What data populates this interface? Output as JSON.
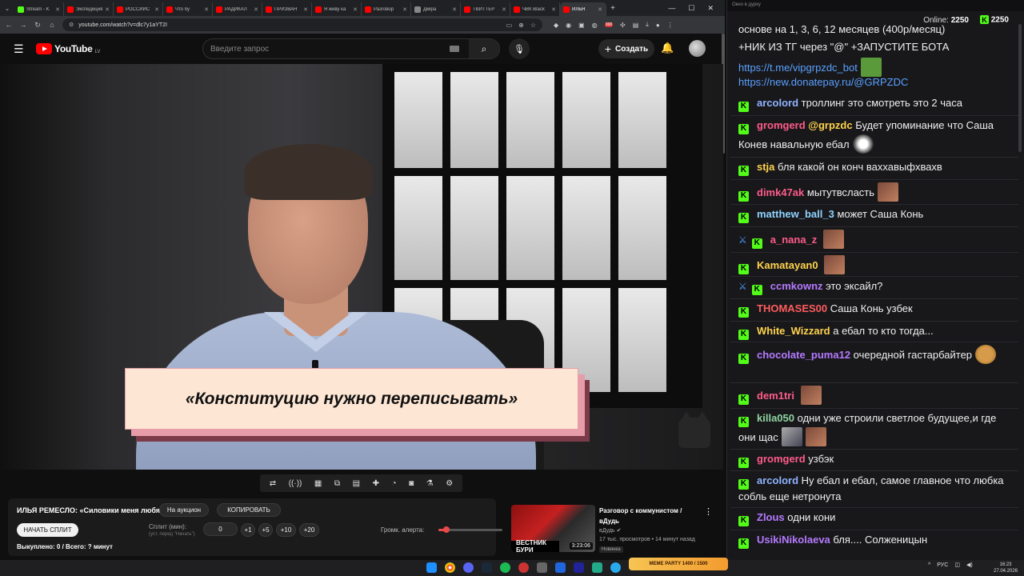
{
  "browser": {
    "tabs": [
      {
        "label": "Stream - K",
        "color": "#53fc18"
      },
      {
        "label": "Экспедиция",
        "color": "#ff0000"
      },
      {
        "label": "РОССИЙС",
        "color": "#ff0000"
      },
      {
        "label": "Что бу",
        "color": "#ff0000"
      },
      {
        "label": "РАДИКАЛ",
        "color": "#ff0000"
      },
      {
        "label": "ПРИЗВАН",
        "color": "#ff0000"
      },
      {
        "label": "Я живу ка",
        "color": "#ff0000"
      },
      {
        "label": "Разговор",
        "color": "#ff0000"
      },
      {
        "label": "Дмірa",
        "color": "#888888"
      },
      {
        "label": "ТВИТТЕР",
        "color": "#ff0000"
      },
      {
        "label": "ЧВК Black",
        "color": "#ff0000"
      },
      {
        "label": "ИЛЬЯ",
        "color": "#ff0000",
        "active": true
      }
    ],
    "url": "youtube.com/watch?v=dlc7y1aYT2I"
  },
  "youtube": {
    "logo_text": "YouTube",
    "country": "LV",
    "search_placeholder": "Введите запрос",
    "create_label": "Создать"
  },
  "video": {
    "quote": "«Конституцию нужно переписывать»"
  },
  "toolbar_icons": [
    "loop-icon",
    "audio-icon",
    "clip-icon",
    "pip-icon",
    "subtitles-icon",
    "cut-icon",
    "speed-icon",
    "screenshot-icon",
    "effects-icon",
    "settings-icon"
  ],
  "info_panel": {
    "title": "ИЛЬЯ РЕМЕСЛО: «Силовики меня любят»",
    "auction_label": "На аукцион",
    "copy_label": "КОПИРОВАТЬ",
    "start_split_label": "НАЧАТЬ СПЛИТ",
    "split_label": "Сплит (мин):",
    "split_hint": "(уст. перед \"Начать\")",
    "split_value": "0",
    "steps": [
      "+1",
      "+5",
      "+10",
      "+20"
    ],
    "volume_label": "Громк. алерта:",
    "volume_fraction": 0.12,
    "bought_text": "Выкуплено: 0 / Всего: ? минут"
  },
  "recommendation": {
    "thumb_band": "ВЕСТНИК БУРИ",
    "duration": "3:23:06",
    "title": "Разговор с коммунистом / вДудь",
    "channel": "вДудь",
    "meta": "17 тыс. просмотров • 14 минут назад",
    "badge": "Новинка"
  },
  "chat": {
    "window_title": "Окно в дурку",
    "online_label": "Online:",
    "online_value": "2250",
    "kick_count": "2250",
    "top_lines": [
      "основе       на 1, 3, 6, 12 месяцев (400р/месяц)",
      "+НИК ИЗ ТГ через \"@\" +ЗАПУСТИТЕ БОТА",
      "https://t.me/vipgrpzdc_bot",
      "https://new.donatepay.ru/@GRPZDC"
    ],
    "messages": [
      {
        "user": "arcolord",
        "color": "#8fb4ff",
        "text": "троллинг это смотреть это 2 часа"
      },
      {
        "user": "gromgerd",
        "color": "#ff5c8a",
        "mention": "@grpzdc",
        "text": "Будет упоминание что Саша Конев навальную ебал",
        "emote": "cat"
      },
      {
        "user": "stja",
        "color": "#ffd34d",
        "text": "бля какой он конч ваххавыфхвахв"
      },
      {
        "user": "dimk47ak",
        "color": "#ff5c8a",
        "text": "мытутвсласть",
        "emote": "face"
      },
      {
        "user": "matthew_ball_3",
        "color": "#8fd3ff",
        "text": "может Саша Конь"
      },
      {
        "user": "a_nana_z",
        "color": "#ff5c8a",
        "text": "",
        "sword": true,
        "emote": "face"
      },
      {
        "user": "Kamatayan0",
        "color": "#ffd34d",
        "text": "",
        "emote": "face"
      },
      {
        "user": "ccmkownz",
        "color": "#b57aff",
        "text": "это эксайл?",
        "sword": true
      },
      {
        "user": "THOMASES00",
        "color": "#ff5c5c",
        "text": "Саша Конь узбек"
      },
      {
        "user": "White_Wizzard",
        "color": "#ffd34d",
        "text": "а ебал то кто тогда..."
      },
      {
        "user": "chocolate_puma12",
        "color": "#b57aff",
        "text": "очередной гастарбайтер",
        "emote": "bear"
      },
      {
        "user": "dem1tri",
        "color": "#ff5c8a",
        "text": "",
        "emote": "face"
      },
      {
        "user": "killa050",
        "color": "#8fd3a0",
        "text": "одни уже строили светлое будущее,и где они щас",
        "emote": "knife"
      },
      {
        "user": "gromgerd",
        "color": "#ff5c8a",
        "text": "узбэк"
      },
      {
        "user": "arcolord",
        "color": "#8fb4ff",
        "text": "Ну ебал и ебал, самое главное что любка собль еще нетронута"
      },
      {
        "user": "Zlous",
        "color": "#b57aff",
        "text": "одни кони"
      },
      {
        "user": "UsikiNikolaeva",
        "color": "#b57aff",
        "text": "бля.... Солженицын"
      }
    ]
  },
  "taskbar": {
    "meme_label": "MEME PARTY",
    "meme_progress": "1400 / 1500",
    "lang": "РУС",
    "time": "16:23",
    "date": "27.04.2026"
  }
}
